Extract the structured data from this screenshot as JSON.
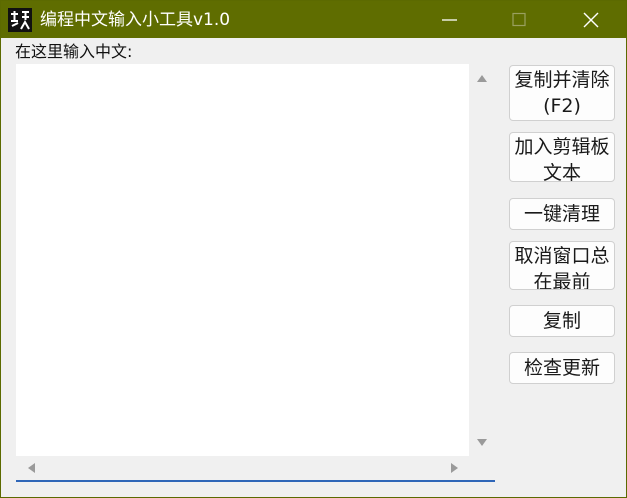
{
  "window": {
    "title": "编程中文输入小工具v1.0",
    "colors": {
      "titlebar": "#5f6d00",
      "title_text": "#ffffff",
      "text_area_focus_line": "#2f66b8"
    },
    "controls": {
      "minimize_icon": "minimize-icon",
      "maximize_icon": "maximize-icon",
      "close_icon": "close-icon"
    }
  },
  "main": {
    "prompt_label": "在这里输入中文:",
    "text_area_value": ""
  },
  "buttons": {
    "copy_and_clear": "复制并清除\n(F2)",
    "add_clipboard_text": "加入剪辑板\n文本",
    "one_click_clear": "一键清理",
    "cancel_topmost": "取消窗口总\n在最前",
    "copy": "复制",
    "check_update": "检查更新"
  }
}
